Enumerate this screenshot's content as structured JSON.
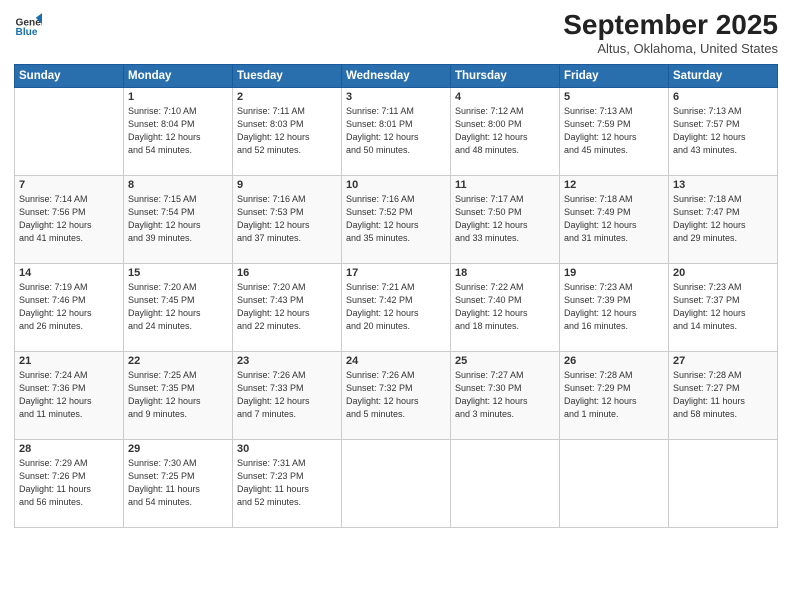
{
  "header": {
    "logo_general": "General",
    "logo_blue": "Blue",
    "title": "September 2025",
    "location": "Altus, Oklahoma, United States"
  },
  "weekdays": [
    "Sunday",
    "Monday",
    "Tuesday",
    "Wednesday",
    "Thursday",
    "Friday",
    "Saturday"
  ],
  "weeks": [
    [
      {
        "day": "",
        "info": ""
      },
      {
        "day": "1",
        "info": "Sunrise: 7:10 AM\nSunset: 8:04 PM\nDaylight: 12 hours\nand 54 minutes."
      },
      {
        "day": "2",
        "info": "Sunrise: 7:11 AM\nSunset: 8:03 PM\nDaylight: 12 hours\nand 52 minutes."
      },
      {
        "day": "3",
        "info": "Sunrise: 7:11 AM\nSunset: 8:01 PM\nDaylight: 12 hours\nand 50 minutes."
      },
      {
        "day": "4",
        "info": "Sunrise: 7:12 AM\nSunset: 8:00 PM\nDaylight: 12 hours\nand 48 minutes."
      },
      {
        "day": "5",
        "info": "Sunrise: 7:13 AM\nSunset: 7:59 PM\nDaylight: 12 hours\nand 45 minutes."
      },
      {
        "day": "6",
        "info": "Sunrise: 7:13 AM\nSunset: 7:57 PM\nDaylight: 12 hours\nand 43 minutes."
      }
    ],
    [
      {
        "day": "7",
        "info": "Sunrise: 7:14 AM\nSunset: 7:56 PM\nDaylight: 12 hours\nand 41 minutes."
      },
      {
        "day": "8",
        "info": "Sunrise: 7:15 AM\nSunset: 7:54 PM\nDaylight: 12 hours\nand 39 minutes."
      },
      {
        "day": "9",
        "info": "Sunrise: 7:16 AM\nSunset: 7:53 PM\nDaylight: 12 hours\nand 37 minutes."
      },
      {
        "day": "10",
        "info": "Sunrise: 7:16 AM\nSunset: 7:52 PM\nDaylight: 12 hours\nand 35 minutes."
      },
      {
        "day": "11",
        "info": "Sunrise: 7:17 AM\nSunset: 7:50 PM\nDaylight: 12 hours\nand 33 minutes."
      },
      {
        "day": "12",
        "info": "Sunrise: 7:18 AM\nSunset: 7:49 PM\nDaylight: 12 hours\nand 31 minutes."
      },
      {
        "day": "13",
        "info": "Sunrise: 7:18 AM\nSunset: 7:47 PM\nDaylight: 12 hours\nand 29 minutes."
      }
    ],
    [
      {
        "day": "14",
        "info": "Sunrise: 7:19 AM\nSunset: 7:46 PM\nDaylight: 12 hours\nand 26 minutes."
      },
      {
        "day": "15",
        "info": "Sunrise: 7:20 AM\nSunset: 7:45 PM\nDaylight: 12 hours\nand 24 minutes."
      },
      {
        "day": "16",
        "info": "Sunrise: 7:20 AM\nSunset: 7:43 PM\nDaylight: 12 hours\nand 22 minutes."
      },
      {
        "day": "17",
        "info": "Sunrise: 7:21 AM\nSunset: 7:42 PM\nDaylight: 12 hours\nand 20 minutes."
      },
      {
        "day": "18",
        "info": "Sunrise: 7:22 AM\nSunset: 7:40 PM\nDaylight: 12 hours\nand 18 minutes."
      },
      {
        "day": "19",
        "info": "Sunrise: 7:23 AM\nSunset: 7:39 PM\nDaylight: 12 hours\nand 16 minutes."
      },
      {
        "day": "20",
        "info": "Sunrise: 7:23 AM\nSunset: 7:37 PM\nDaylight: 12 hours\nand 14 minutes."
      }
    ],
    [
      {
        "day": "21",
        "info": "Sunrise: 7:24 AM\nSunset: 7:36 PM\nDaylight: 12 hours\nand 11 minutes."
      },
      {
        "day": "22",
        "info": "Sunrise: 7:25 AM\nSunset: 7:35 PM\nDaylight: 12 hours\nand 9 minutes."
      },
      {
        "day": "23",
        "info": "Sunrise: 7:26 AM\nSunset: 7:33 PM\nDaylight: 12 hours\nand 7 minutes."
      },
      {
        "day": "24",
        "info": "Sunrise: 7:26 AM\nSunset: 7:32 PM\nDaylight: 12 hours\nand 5 minutes."
      },
      {
        "day": "25",
        "info": "Sunrise: 7:27 AM\nSunset: 7:30 PM\nDaylight: 12 hours\nand 3 minutes."
      },
      {
        "day": "26",
        "info": "Sunrise: 7:28 AM\nSunset: 7:29 PM\nDaylight: 12 hours\nand 1 minute."
      },
      {
        "day": "27",
        "info": "Sunrise: 7:28 AM\nSunset: 7:27 PM\nDaylight: 11 hours\nand 58 minutes."
      }
    ],
    [
      {
        "day": "28",
        "info": "Sunrise: 7:29 AM\nSunset: 7:26 PM\nDaylight: 11 hours\nand 56 minutes."
      },
      {
        "day": "29",
        "info": "Sunrise: 7:30 AM\nSunset: 7:25 PM\nDaylight: 11 hours\nand 54 minutes."
      },
      {
        "day": "30",
        "info": "Sunrise: 7:31 AM\nSunset: 7:23 PM\nDaylight: 11 hours\nand 52 minutes."
      },
      {
        "day": "",
        "info": ""
      },
      {
        "day": "",
        "info": ""
      },
      {
        "day": "",
        "info": ""
      },
      {
        "day": "",
        "info": ""
      }
    ]
  ]
}
